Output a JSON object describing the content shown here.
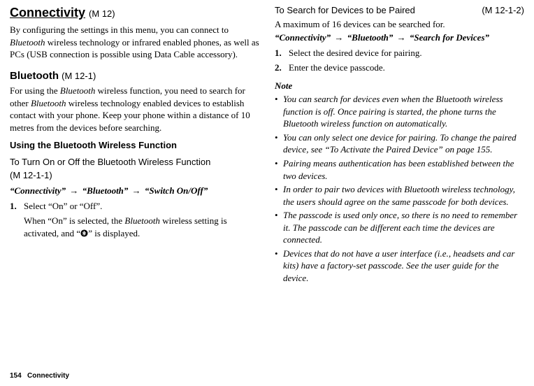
{
  "left": {
    "heading_main": "Connectivity",
    "heading_main_code": "(M 12)",
    "intro_1": "By configuring the settings in this menu, you can connect to ",
    "intro_bt": "Bluetooth",
    "intro_2": " wireless technology or infrared enabled phones, as well as PCs (USB connection is possible using Data Cable accessory).",
    "bt_heading": "Bluetooth",
    "bt_heading_code": "(M 12-1)",
    "bt_body_1": "For using the ",
    "bt_body_2": " wireless function, you need to search for other ",
    "bt_body_3": " wireless technology enabled devices to establish contact with your phone. Keep your phone within a distance of 10 metres from the devices before searching.",
    "using_heading": "Using the Bluetooth Wireless Function",
    "toggle_title": "To Turn On or Off the Bluetooth Wireless Function",
    "toggle_code": "(M 12-1-1)",
    "nav_connectivity": "“Connectivity”",
    "nav_bluetooth": "“Bluetooth”",
    "nav_switch": "“Switch On/Off”",
    "step1_num": "1.",
    "step1_text": "Select “On” or “Off”.",
    "step1_note_1": "When “On” is selected, the ",
    "step1_note_2": " wireless setting is activated, and “",
    "step1_note_3": "” is displayed."
  },
  "right": {
    "search_title": "To Search for Devices to be Paired",
    "search_code": "(M 12-1-2)",
    "search_body": "A maximum of 16 devices can be searched for.",
    "nav_connectivity": "“Connectivity”",
    "nav_bluetooth": "“Bluetooth”",
    "nav_search": "“Search for Devices”",
    "step1_num": "1.",
    "step1_text": "Select the desired device for pairing.",
    "step2_num": "2.",
    "step2_text": "Enter the device passcode.",
    "note_heading": "Note",
    "notes": [
      "You can search for devices even when the Bluetooth wireless function is off. Once pairing is started, the phone turns the Bluetooth wireless function on automatically.",
      "You can only select one device for pairing. To change the paired device, see “To Activate the Paired Device” on page 155.",
      "Pairing means authentication has been established between the two devices.",
      "In order to pair two devices with Bluetooth wireless technology, the users should agree on the same passcode for both devices.",
      "The passcode is used only once, so there is no need to remember it. The passcode can be different each time the devices are connected.",
      "Devices that do not have a user interface (i.e., headsets and car kits) have a factory-set passcode. See the user guide for the device."
    ]
  },
  "footer_page": "154",
  "footer_section": "Connectivity",
  "arrow": "→",
  "bullet": "•"
}
